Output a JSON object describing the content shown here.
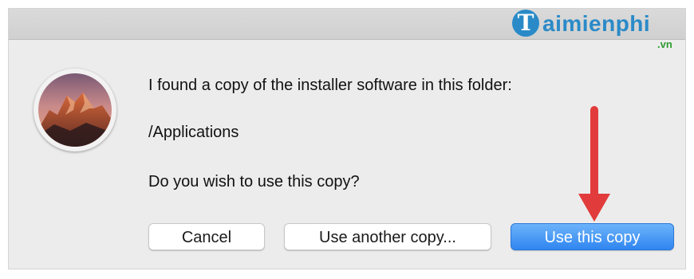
{
  "dialog": {
    "message": "I found a copy of the installer software in this folder:",
    "path": "/Applications",
    "question": "Do you wish to use this copy?"
  },
  "buttons": {
    "cancel": "Cancel",
    "use_another": "Use another copy...",
    "use_this": "Use this copy"
  },
  "watermark": {
    "brand": "aimienphi",
    "suffix": ".vn"
  },
  "annotation": {
    "arrow_color": "#e23b3b"
  },
  "colors": {
    "accent": "#2f86f0",
    "dialog_bg": "#ececec"
  },
  "icons": {
    "app": "macos-sierra-installer-icon",
    "arrow": "red-down-arrow-annotation"
  }
}
